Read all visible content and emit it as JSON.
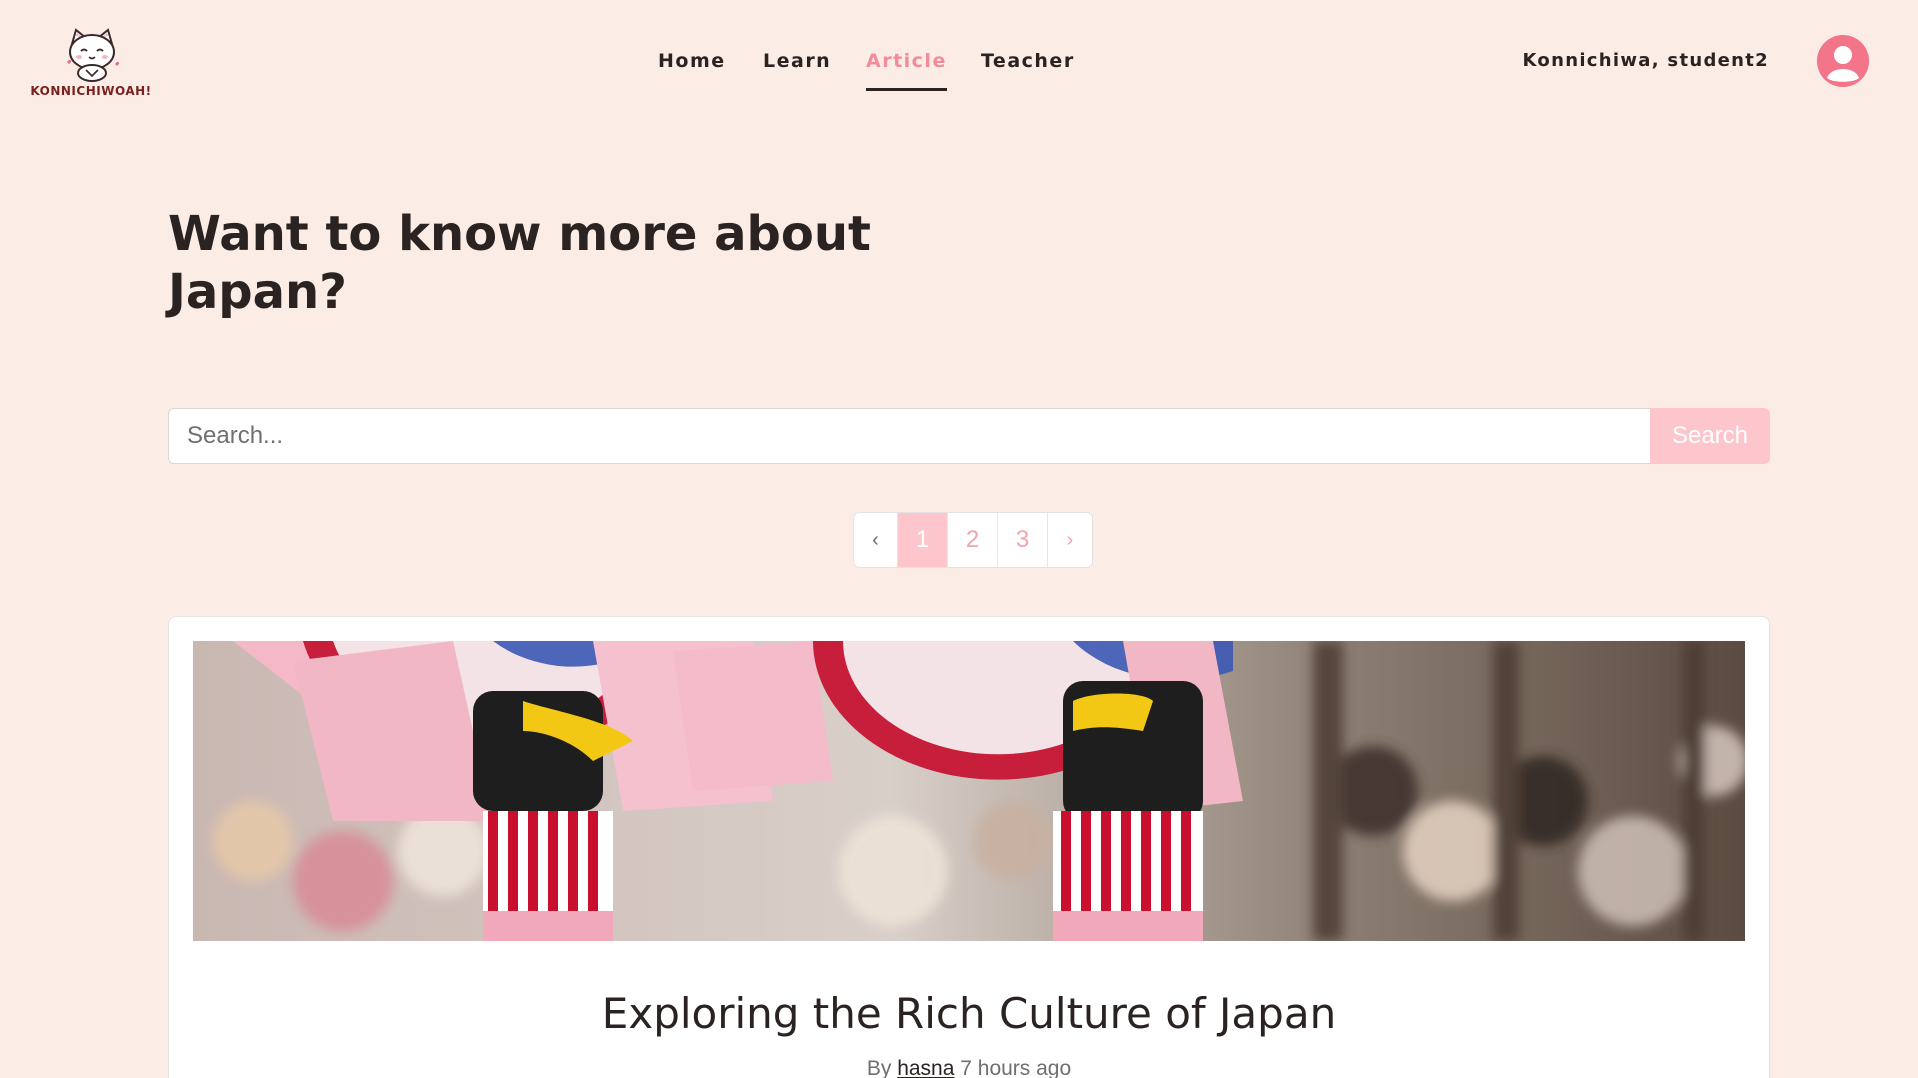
{
  "brand": {
    "logo_text": "KONNICHIWOAH!"
  },
  "nav": {
    "items": [
      {
        "label": "Home",
        "active": false
      },
      {
        "label": "Learn",
        "active": false
      },
      {
        "label": "Article",
        "active": true
      },
      {
        "label": "Teacher",
        "active": false
      }
    ]
  },
  "user": {
    "greeting": "Konnichiwa, student2"
  },
  "hero": {
    "title": "Want to know more about Japan?"
  },
  "search": {
    "placeholder": "Search...",
    "button_label": "Search"
  },
  "pagination": {
    "prev": "‹",
    "next": "›",
    "pages": [
      "1",
      "2",
      "3"
    ],
    "current": "1"
  },
  "article": {
    "title": "Exploring the Rich Culture of Japan",
    "by_label": "By",
    "author": "hasna",
    "time": "7 hours ago"
  },
  "colors": {
    "background": "#fbede6",
    "accent": "#f38b9a",
    "button": "#fcc6cc",
    "avatar": "#f3758a",
    "text": "#2b2321"
  }
}
